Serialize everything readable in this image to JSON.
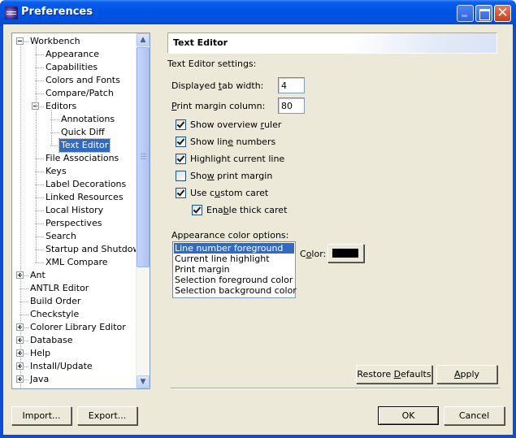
{
  "window": {
    "title": "Preferences",
    "controls": {
      "minimize": "minimize",
      "maximize": "maximize",
      "close": "✕"
    }
  },
  "tree": {
    "items": [
      {
        "label": "Workbench",
        "level": 0,
        "expander": "minus"
      },
      {
        "label": "Appearance",
        "level": 1
      },
      {
        "label": "Capabilities",
        "level": 1
      },
      {
        "label": "Colors and Fonts",
        "level": 1
      },
      {
        "label": "Compare/Patch",
        "level": 1
      },
      {
        "label": "Editors",
        "level": 1,
        "expander": "minus"
      },
      {
        "label": "Annotations",
        "level": 2
      },
      {
        "label": "Quick Diff",
        "level": 2
      },
      {
        "label": "Text Editor",
        "level": 2,
        "selected": true
      },
      {
        "label": "File Associations",
        "level": 1
      },
      {
        "label": "Keys",
        "level": 1
      },
      {
        "label": "Label Decorations",
        "level": 1
      },
      {
        "label": "Linked Resources",
        "level": 1
      },
      {
        "label": "Local History",
        "level": 1
      },
      {
        "label": "Perspectives",
        "level": 1
      },
      {
        "label": "Search",
        "level": 1
      },
      {
        "label": "Startup and Shutdown",
        "level": 1
      },
      {
        "label": "XML Compare",
        "level": 1
      },
      {
        "label": "Ant",
        "level": 0,
        "expander": "plus"
      },
      {
        "label": "ANTLR Editor",
        "level": 0
      },
      {
        "label": "Build Order",
        "level": 0
      },
      {
        "label": "Checkstyle",
        "level": 0
      },
      {
        "label": "Colorer Library Editor",
        "level": 0,
        "expander": "plus"
      },
      {
        "label": "Database",
        "level": 0,
        "expander": "plus"
      },
      {
        "label": "Help",
        "level": 0,
        "expander": "plus"
      },
      {
        "label": "Install/Update",
        "level": 0,
        "expander": "plus"
      },
      {
        "label": "Java",
        "level": 0,
        "expander": "plus"
      }
    ],
    "scroll_up": "⌃",
    "scroll_down": "⌄"
  },
  "page": {
    "title": "Text Editor",
    "settings_label": "Text Editor settings:",
    "tab_width": {
      "label_pre": "Displayed ",
      "label_u": "t",
      "label_post": "ab width:",
      "value": "4"
    },
    "print_margin_column": {
      "label_pre": "",
      "label_u": "P",
      "label_post": "rint margin column:",
      "value": "80"
    },
    "checkboxes": [
      {
        "pre": "Show overview ",
        "u": "r",
        "post": "uler",
        "checked": true
      },
      {
        "pre": "Show lin",
        "u": "e",
        "post": " numbers",
        "checked": true
      },
      {
        "pre": "Highlight current line",
        "u": "",
        "post": "",
        "checked": true
      },
      {
        "pre": "Sho",
        "u": "w",
        "post": " print margin",
        "checked": false
      },
      {
        "pre": "Use c",
        "u": "u",
        "post": "stom caret",
        "checked": true
      },
      {
        "pre": "Ena",
        "u": "b",
        "post": "le thick caret",
        "checked": true
      }
    ],
    "appearance_label": "Appearance color options:",
    "color_options": [
      {
        "label": "Line number foreground",
        "selected": true
      },
      {
        "label": "Current line highlight"
      },
      {
        "label": "Print margin"
      },
      {
        "label": "Selection foreground color"
      },
      {
        "label": "Selection background color"
      }
    ],
    "color_label_pre": "C",
    "color_label_u": "o",
    "color_label_post": "lor:",
    "color_value": "#000000",
    "restore_defaults_pre": "Restore ",
    "restore_defaults_u": "D",
    "restore_defaults_post": "efaults",
    "apply_u": "A",
    "apply_post": "pply"
  },
  "footer": {
    "import": "Import...",
    "export": "Export...",
    "ok": "OK",
    "cancel": "Cancel"
  }
}
